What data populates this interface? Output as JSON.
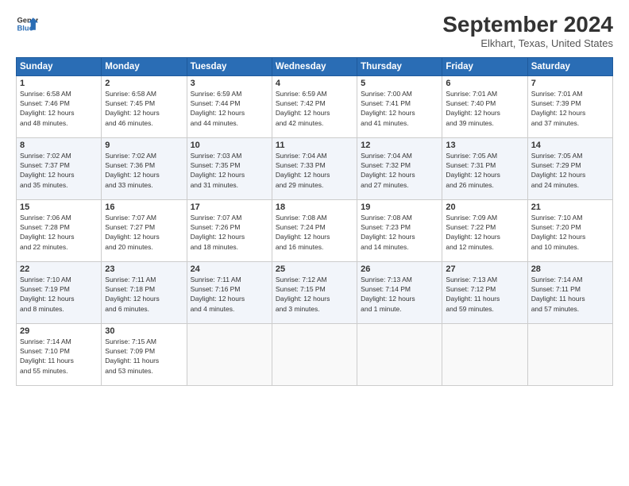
{
  "header": {
    "logo_line1": "General",
    "logo_line2": "Blue",
    "month": "September 2024",
    "location": "Elkhart, Texas, United States"
  },
  "columns": [
    "Sunday",
    "Monday",
    "Tuesday",
    "Wednesday",
    "Thursday",
    "Friday",
    "Saturday"
  ],
  "weeks": [
    [
      {
        "day": "1",
        "info": "Sunrise: 6:58 AM\nSunset: 7:46 PM\nDaylight: 12 hours\nand 48 minutes."
      },
      {
        "day": "2",
        "info": "Sunrise: 6:58 AM\nSunset: 7:45 PM\nDaylight: 12 hours\nand 46 minutes."
      },
      {
        "day": "3",
        "info": "Sunrise: 6:59 AM\nSunset: 7:44 PM\nDaylight: 12 hours\nand 44 minutes."
      },
      {
        "day": "4",
        "info": "Sunrise: 6:59 AM\nSunset: 7:42 PM\nDaylight: 12 hours\nand 42 minutes."
      },
      {
        "day": "5",
        "info": "Sunrise: 7:00 AM\nSunset: 7:41 PM\nDaylight: 12 hours\nand 41 minutes."
      },
      {
        "day": "6",
        "info": "Sunrise: 7:01 AM\nSunset: 7:40 PM\nDaylight: 12 hours\nand 39 minutes."
      },
      {
        "day": "7",
        "info": "Sunrise: 7:01 AM\nSunset: 7:39 PM\nDaylight: 12 hours\nand 37 minutes."
      }
    ],
    [
      {
        "day": "8",
        "info": "Sunrise: 7:02 AM\nSunset: 7:37 PM\nDaylight: 12 hours\nand 35 minutes."
      },
      {
        "day": "9",
        "info": "Sunrise: 7:02 AM\nSunset: 7:36 PM\nDaylight: 12 hours\nand 33 minutes."
      },
      {
        "day": "10",
        "info": "Sunrise: 7:03 AM\nSunset: 7:35 PM\nDaylight: 12 hours\nand 31 minutes."
      },
      {
        "day": "11",
        "info": "Sunrise: 7:04 AM\nSunset: 7:33 PM\nDaylight: 12 hours\nand 29 minutes."
      },
      {
        "day": "12",
        "info": "Sunrise: 7:04 AM\nSunset: 7:32 PM\nDaylight: 12 hours\nand 27 minutes."
      },
      {
        "day": "13",
        "info": "Sunrise: 7:05 AM\nSunset: 7:31 PM\nDaylight: 12 hours\nand 26 minutes."
      },
      {
        "day": "14",
        "info": "Sunrise: 7:05 AM\nSunset: 7:29 PM\nDaylight: 12 hours\nand 24 minutes."
      }
    ],
    [
      {
        "day": "15",
        "info": "Sunrise: 7:06 AM\nSunset: 7:28 PM\nDaylight: 12 hours\nand 22 minutes."
      },
      {
        "day": "16",
        "info": "Sunrise: 7:07 AM\nSunset: 7:27 PM\nDaylight: 12 hours\nand 20 minutes."
      },
      {
        "day": "17",
        "info": "Sunrise: 7:07 AM\nSunset: 7:26 PM\nDaylight: 12 hours\nand 18 minutes."
      },
      {
        "day": "18",
        "info": "Sunrise: 7:08 AM\nSunset: 7:24 PM\nDaylight: 12 hours\nand 16 minutes."
      },
      {
        "day": "19",
        "info": "Sunrise: 7:08 AM\nSunset: 7:23 PM\nDaylight: 12 hours\nand 14 minutes."
      },
      {
        "day": "20",
        "info": "Sunrise: 7:09 AM\nSunset: 7:22 PM\nDaylight: 12 hours\nand 12 minutes."
      },
      {
        "day": "21",
        "info": "Sunrise: 7:10 AM\nSunset: 7:20 PM\nDaylight: 12 hours\nand 10 minutes."
      }
    ],
    [
      {
        "day": "22",
        "info": "Sunrise: 7:10 AM\nSunset: 7:19 PM\nDaylight: 12 hours\nand 8 minutes."
      },
      {
        "day": "23",
        "info": "Sunrise: 7:11 AM\nSunset: 7:18 PM\nDaylight: 12 hours\nand 6 minutes."
      },
      {
        "day": "24",
        "info": "Sunrise: 7:11 AM\nSunset: 7:16 PM\nDaylight: 12 hours\nand 4 minutes."
      },
      {
        "day": "25",
        "info": "Sunrise: 7:12 AM\nSunset: 7:15 PM\nDaylight: 12 hours\nand 3 minutes."
      },
      {
        "day": "26",
        "info": "Sunrise: 7:13 AM\nSunset: 7:14 PM\nDaylight: 12 hours\nand 1 minute."
      },
      {
        "day": "27",
        "info": "Sunrise: 7:13 AM\nSunset: 7:12 PM\nDaylight: 11 hours\nand 59 minutes."
      },
      {
        "day": "28",
        "info": "Sunrise: 7:14 AM\nSunset: 7:11 PM\nDaylight: 11 hours\nand 57 minutes."
      }
    ],
    [
      {
        "day": "29",
        "info": "Sunrise: 7:14 AM\nSunset: 7:10 PM\nDaylight: 11 hours\nand 55 minutes."
      },
      {
        "day": "30",
        "info": "Sunrise: 7:15 AM\nSunset: 7:09 PM\nDaylight: 11 hours\nand 53 minutes."
      },
      null,
      null,
      null,
      null,
      null
    ]
  ]
}
